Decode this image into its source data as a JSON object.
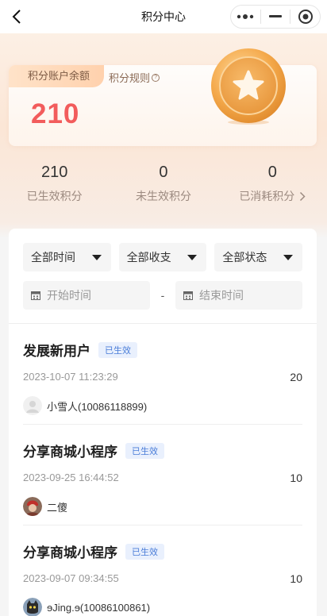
{
  "nav": {
    "title": "积分中心"
  },
  "balance": {
    "tag_label": "积分账户余额",
    "rules_label": "积分规则",
    "value": "210"
  },
  "stats": [
    {
      "value": "210",
      "label": "已生效积分"
    },
    {
      "value": "0",
      "label": "未生效积分"
    },
    {
      "value": "0",
      "label": "已消耗积分"
    }
  ],
  "filters": {
    "time": "全部时间",
    "type": "全部收支",
    "status": "全部状态",
    "start_placeholder": "开始时间",
    "end_placeholder": "结束时间",
    "dash": "-"
  },
  "records": [
    {
      "title": "发展新用户",
      "badge": "已生效",
      "time": "2023-10-07 11:23:29",
      "points": "20",
      "user": "小雪人(10086118899)"
    },
    {
      "title": "分享商城小程序",
      "badge": "已生效",
      "time": "2023-09-25 16:44:52",
      "points": "10",
      "user": "二傻"
    },
    {
      "title": "分享商城小程序",
      "badge": "已生效",
      "time": "2023-09-07 09:34:55",
      "points": "10",
      "user": "ɘJing.ɘ(10086100861)"
    }
  ]
}
